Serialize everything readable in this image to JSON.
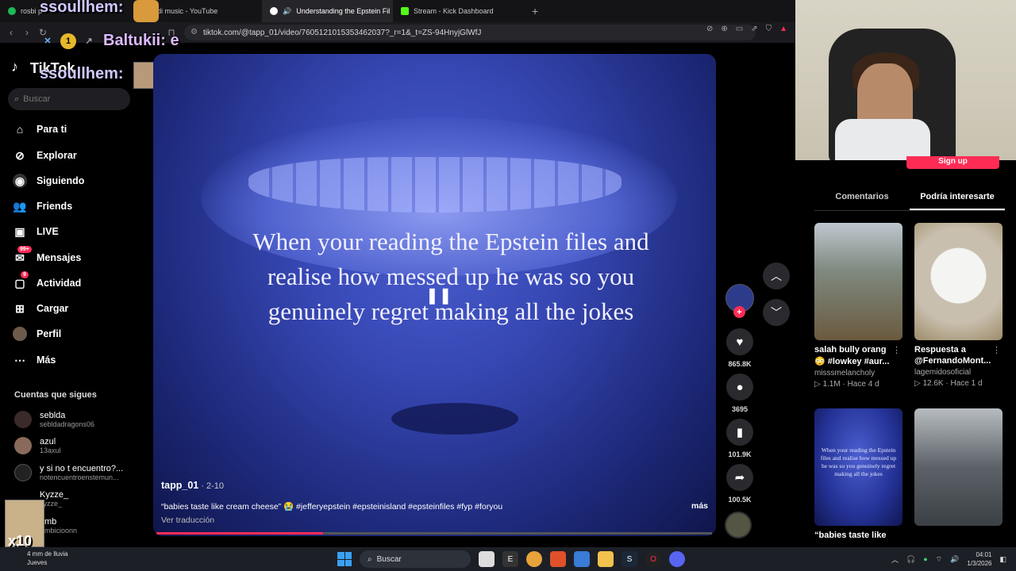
{
  "browser": {
    "tabs": [
      {
        "label": "rosbi p",
        "icon": "spotify-icon",
        "color": "#1db954"
      },
      {
        "label": "bidi music - YouTube",
        "icon": "youtube-icon",
        "color": "#ff0000"
      },
      {
        "label": "Understanding the Epstein Fil",
        "icon": "tiktok-icon",
        "color": "#ffffff",
        "active": true
      },
      {
        "label": "Stream - Kick Dashboard",
        "icon": "kick-icon",
        "color": "#53fc18"
      }
    ],
    "new_tab": "+",
    "close": "×",
    "url": "tiktok.com/@tapp_01/video/7605121015353462037?_r=1&_t=ZS-94HnyjGlWfJ"
  },
  "overlay": {
    "chat_name_1": "ssoullhem:",
    "chat_name_2": "Baltukii: e",
    "chat_name_3": "ssoullhem:",
    "badge_count": "1",
    "multiplier": "x10"
  },
  "sidebar": {
    "logo": "TikTok",
    "search_placeholder": "Buscar",
    "items": [
      {
        "label": "Para ti",
        "icon": "home-icon"
      },
      {
        "label": "Explorar",
        "icon": "compass-icon"
      },
      {
        "label": "Siguiendo",
        "icon": "following-icon"
      },
      {
        "label": "Friends",
        "icon": "friends-icon"
      },
      {
        "label": "LIVE",
        "icon": "live-icon"
      },
      {
        "label": "Mensajes",
        "icon": "message-icon",
        "badge": "99+"
      },
      {
        "label": "Actividad",
        "icon": "activity-icon",
        "badge": "9"
      },
      {
        "label": "Cargar",
        "icon": "upload-icon"
      },
      {
        "label": "Perfil",
        "icon": "profile-icon"
      },
      {
        "label": "Más",
        "icon": "more-icon"
      }
    ],
    "following_title": "Cuentas que sigues",
    "following": [
      {
        "name": "seblda",
        "handle": "sebldadragons06"
      },
      {
        "name": "azul",
        "handle": "13axul"
      },
      {
        "name": "y si no t encuentro?...",
        "handle": "notencuentroenstemun..."
      },
      {
        "name": "Kyzze_",
        "handle": "kyzze_"
      },
      {
        "name": "mb",
        "handle": "mbicioonn"
      }
    ]
  },
  "video": {
    "caption": "When your reading the Epstein files and realise how messed up he was so you genuinely regret making all the jokes",
    "username": "tapp_01",
    "date": " · 2-10",
    "description": "“babies taste like cream cheese” 😭 #jefferyepstein #epsteinisland #epsteinfiles #fyp #foryou",
    "more": "más",
    "translate": "Ver traducción",
    "progress": 0.3,
    "likes": "865.8K",
    "comments": "3695",
    "saves": "101.9K",
    "shares": "100.5K"
  },
  "right_panel": {
    "signup": "Sign up",
    "tabs": [
      "Comentarios",
      "Podría interesarte"
    ],
    "recommendations": [
      {
        "line1": "salah bully orang",
        "line2": "😳 #lowkey #aur...",
        "author": "misssmelancholy",
        "stats": "▷ 1.1M · Hace 4 d"
      },
      {
        "line1": "Respuesta a",
        "line2": "@FernandoMont...",
        "author": "lagemidosoficial",
        "stats": "▷ 12.6K · Hace 1 d"
      },
      {
        "line1": "“babies taste like",
        "line2": "",
        "author": "",
        "stats": ""
      },
      {
        "line1": "",
        "line2": "",
        "author": "",
        "stats": ""
      }
    ],
    "thumb_caption": "When your reading the Epstein files and realise how messed up he was so you genuinely regret making all the jokes"
  },
  "taskbar": {
    "weather_line1": "4 mm de lluvia",
    "weather_line2": "Jueves",
    "search": "Buscar",
    "time": "04:01",
    "date": "1/3/2026"
  }
}
